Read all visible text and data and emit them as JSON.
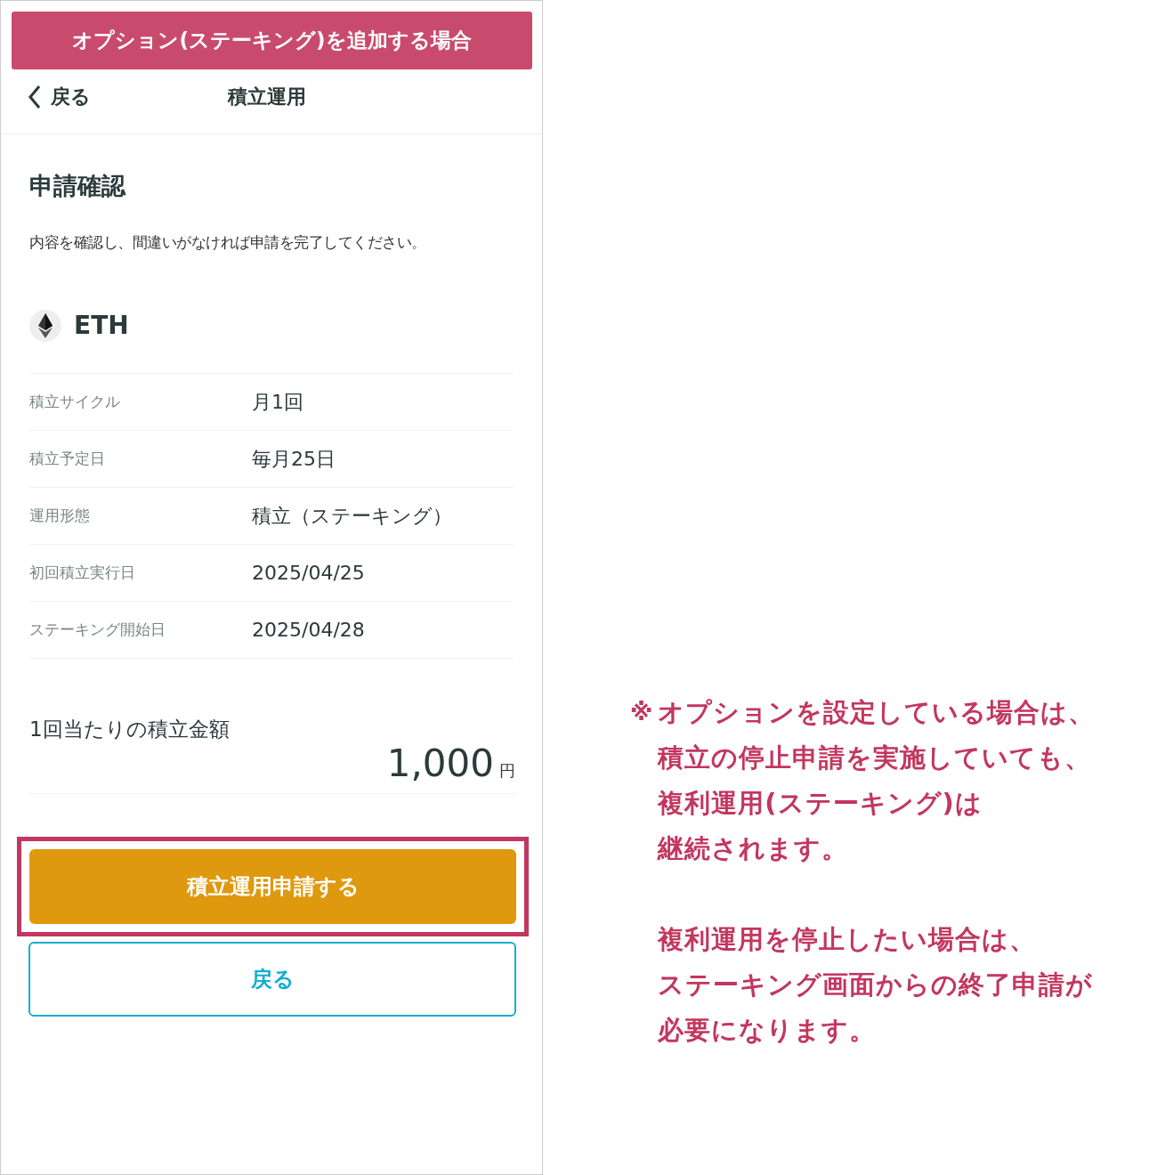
{
  "banner": "オプション(ステーキング)を追加する場合",
  "nav": {
    "back": "戻る",
    "title": "積立運用"
  },
  "heading": "申請確認",
  "description": "内容を確認し、間違いがなければ申請を完了してください。",
  "coin": "ETH",
  "details": [
    {
      "label": "積立サイクル",
      "value": "月1回"
    },
    {
      "label": "積立予定日",
      "value": "毎月25日"
    },
    {
      "label": "運用形態",
      "value": "積立（ステーキング）"
    },
    {
      "label": "初回積立実行日",
      "value": "2025/04/25"
    },
    {
      "label": "ステーキング開始日",
      "value": "2025/04/28"
    }
  ],
  "amount": {
    "label": "1回当たりの積立金額",
    "value": "1,000",
    "unit": "円"
  },
  "buttons": {
    "primary": "積立運用申請する",
    "secondary": "戻る"
  },
  "note": {
    "mark": "※",
    "paragraphs": [
      [
        "オプションを設定している場合は、",
        "積立の停止申請を実施していても、",
        "複利運用(ステーキング)は",
        "継続されます。"
      ],
      [
        "複利運用を停止したい場合は、",
        "ステーキング画面からの終了申請が",
        "必要になります。"
      ]
    ]
  }
}
